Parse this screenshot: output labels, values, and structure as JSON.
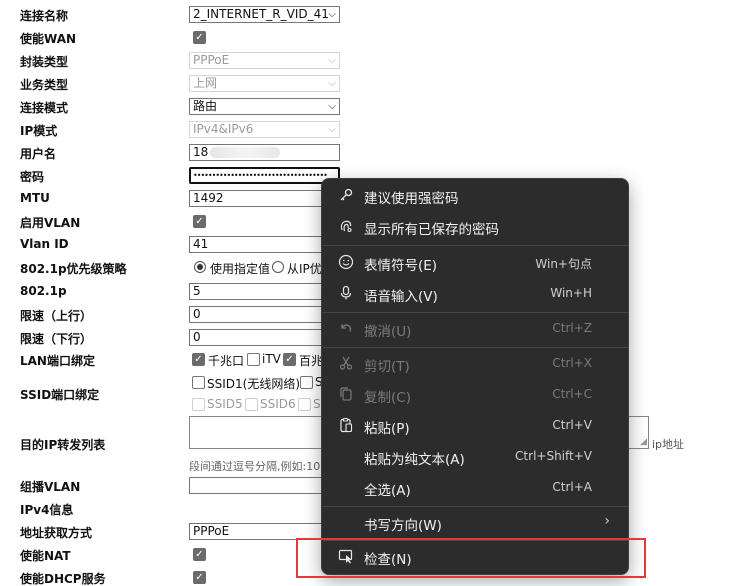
{
  "form": {
    "rows": [
      {
        "label": "连接名称",
        "value": "2_INTERNET_R_VID_41"
      },
      {
        "label": "使能WAN"
      },
      {
        "label": "封装类型",
        "value": "PPPoE"
      },
      {
        "label": "业务类型",
        "value": "上网"
      },
      {
        "label": "连接模式",
        "value": "路由"
      },
      {
        "label": "IP模式",
        "value": "IPv4&IPv6"
      },
      {
        "label": "用户名",
        "value": "18"
      },
      {
        "label": "密码",
        "value": "••••••••••••••••••••••••••••••••••••"
      },
      {
        "label": "MTU",
        "value": "1492"
      },
      {
        "label": "启用VLAN"
      },
      {
        "label": "Vlan ID",
        "value": "41"
      },
      {
        "label": "802.1p优先级策略"
      },
      {
        "label": "802.1p",
        "value": "5"
      },
      {
        "label": "限速（上行）",
        "value": "0"
      },
      {
        "label": "限速（下行）",
        "value": "0"
      },
      {
        "label": "LAN端口绑定"
      },
      {
        "label": "SSID端口绑定"
      },
      {
        "label": "目的IP转发列表"
      },
      {
        "label": "组播VLAN"
      },
      {
        "label": "IPv4信息"
      },
      {
        "label": "地址获取方式",
        "value": "PPPoE"
      },
      {
        "label": "使能NAT"
      },
      {
        "label": "使能DHCP服务"
      }
    ],
    "priority": {
      "opt1": "使用指定值",
      "opt2": "从IP优先"
    },
    "lan": {
      "opt1": "千兆口",
      "opt2": "iTV",
      "opt3": "百兆"
    },
    "ssid": {
      "opt1": "SSID1(无线网络)",
      "opt2": "S",
      "opt3": "SSID5",
      "opt4": "SSID6",
      "opt5": "S"
    },
    "dest_ip": {
      "suffix": "ip地址",
      "hint": "段间通过逗号分隔,例如:10"
    }
  },
  "menu": {
    "items": [
      {
        "label": "建议使用强密码",
        "shortcut": "",
        "icon": "key-icon"
      },
      {
        "label": "显示所有已保存的密码",
        "shortcut": "",
        "icon": "fingerprint-key-icon"
      },
      {
        "label": "表情符号(E)",
        "shortcut": "Win+句点",
        "icon": "emoji-icon"
      },
      {
        "label": "语音输入(V)",
        "shortcut": "Win+H",
        "icon": "microphone-icon"
      },
      {
        "label": "撤消(U)",
        "shortcut": "Ctrl+Z",
        "icon": "undo-icon"
      },
      {
        "label": "剪切(T)",
        "shortcut": "Ctrl+X",
        "icon": "scissors-icon"
      },
      {
        "label": "复制(C)",
        "shortcut": "Ctrl+C",
        "icon": "copy-icon"
      },
      {
        "label": "粘贴(P)",
        "shortcut": "Ctrl+V",
        "icon": "paste-icon"
      },
      {
        "label": "粘贴为纯文本(A)",
        "shortcut": "Ctrl+Shift+V",
        "icon": ""
      },
      {
        "label": "全选(A)",
        "shortcut": "Ctrl+A",
        "icon": ""
      },
      {
        "label": "书写方向(W)",
        "shortcut": "",
        "icon": ""
      },
      {
        "label": "检查(N)",
        "shortcut": "",
        "icon": "inspect-icon"
      }
    ]
  },
  "colors": {
    "menu_bg": "#2c2c2c",
    "highlight_box": "#e53935"
  }
}
